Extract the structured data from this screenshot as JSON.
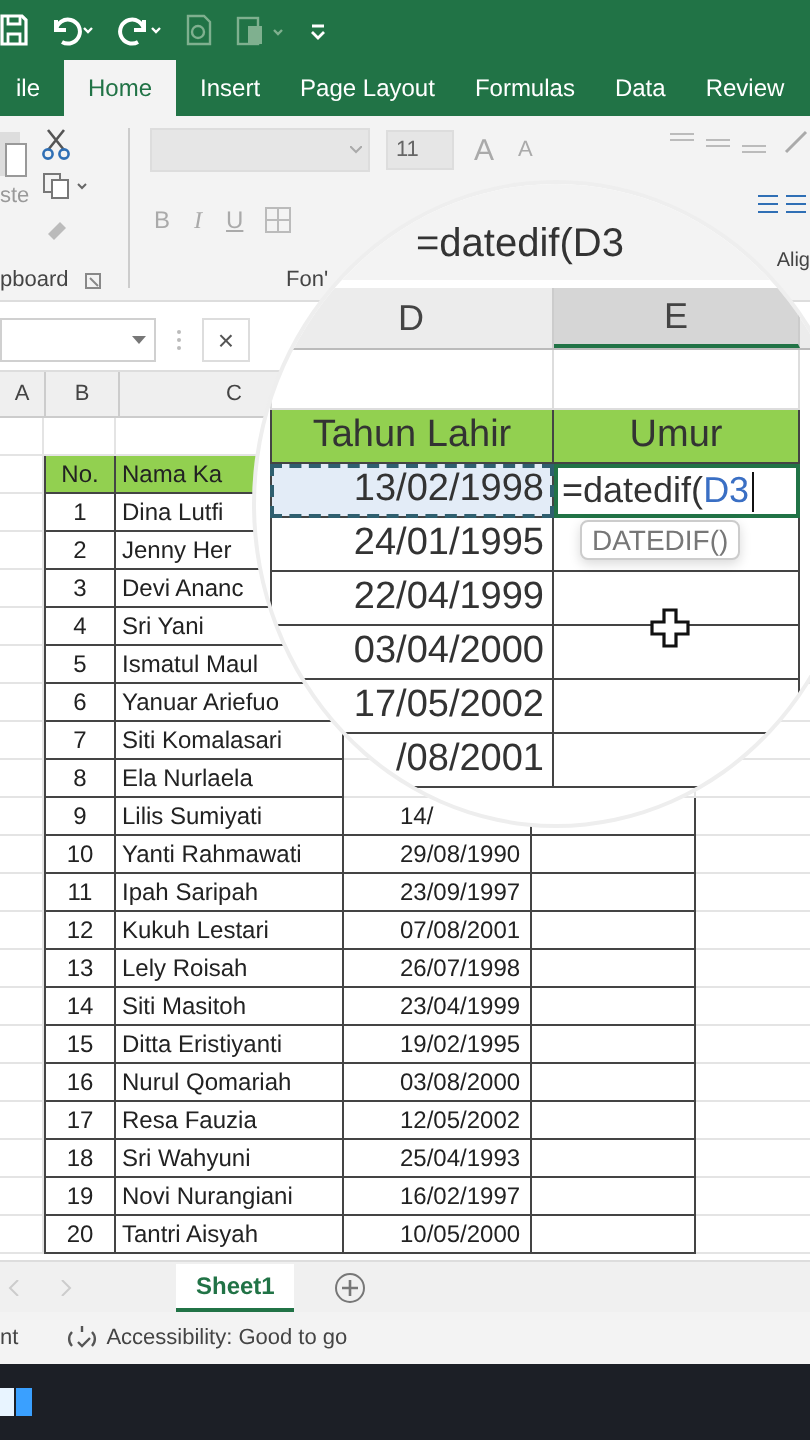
{
  "tabs": [
    {
      "label": "ile",
      "selected": false
    },
    {
      "label": "Home",
      "selected": true
    },
    {
      "label": "Insert",
      "selected": false
    },
    {
      "label": "Page Layout",
      "selected": false
    },
    {
      "label": "Formulas",
      "selected": false
    },
    {
      "label": "Data",
      "selected": false
    },
    {
      "label": "Review",
      "selected": false
    }
  ],
  "ribbon": {
    "clipboard": {
      "paste": "ste",
      "label": "pboard"
    },
    "font": {
      "size": "11",
      "grow": "A",
      "shrink": "A",
      "bold": "B",
      "italic": "I",
      "underline": "U",
      "label": "Fon'"
    },
    "alignment": {
      "label": "Alig"
    }
  },
  "formula_bar": {
    "cancel": "×"
  },
  "columns": [
    "A",
    "B",
    "C"
  ],
  "table": {
    "headers": [
      "No.",
      "Nama Ka"
    ],
    "rows": [
      {
        "no": "1",
        "name": "Dina Lutfi"
      },
      {
        "no": "2",
        "name": "Jenny Her"
      },
      {
        "no": "3",
        "name": "Devi Ananc"
      },
      {
        "no": "4",
        "name": "Sri Yani"
      },
      {
        "no": "5",
        "name": "Ismatul Maul"
      },
      {
        "no": "6",
        "name": "Yanuar Ariefuo"
      },
      {
        "no": "7",
        "name": "Siti Komalasari"
      },
      {
        "no": "8",
        "name": "Ela Nurlaela"
      },
      {
        "no": "9",
        "name": "Lilis Sumiyati",
        "date": "14/"
      },
      {
        "no": "10",
        "name": "Yanti Rahmawati",
        "date": "29/08/1990"
      },
      {
        "no": "11",
        "name": "Ipah Saripah",
        "date": "23/09/1997"
      },
      {
        "no": "12",
        "name": "Kukuh Lestari",
        "date": "07/08/2001"
      },
      {
        "no": "13",
        "name": "Lely Roisah",
        "date": "26/07/1998"
      },
      {
        "no": "14",
        "name": "Siti Masitoh",
        "date": "23/04/1999"
      },
      {
        "no": "15",
        "name": "Ditta Eristiyanti",
        "date": "19/02/1995"
      },
      {
        "no": "16",
        "name": "Nurul Qomariah",
        "date": "03/08/2000"
      },
      {
        "no": "17",
        "name": "Resa Fauzia",
        "date": "12/05/2002"
      },
      {
        "no": "18",
        "name": "Sri Wahyuni",
        "date": "25/04/1993"
      },
      {
        "no": "19",
        "name": "Novi Nurangiani",
        "date": "16/02/1997"
      },
      {
        "no": "20",
        "name": "Tantri Aisyah",
        "date": "10/05/2000"
      }
    ]
  },
  "magnifier": {
    "formula": "=datedif(D3",
    "columns": [
      "D",
      "E"
    ],
    "headers": [
      "Tahun Lahir",
      "Umur"
    ],
    "rows": [
      {
        "date": "13/02/1998",
        "selected": true
      },
      {
        "date": "24/01/1995",
        "selected": false
      },
      {
        "date": "22/04/1999",
        "selected": false
      },
      {
        "date": "03/04/2000",
        "selected": false
      },
      {
        "date": "17/05/2002",
        "selected": false
      },
      {
        "date": "/08/2001",
        "selected": false
      }
    ],
    "editing": {
      "text": "=datedif(",
      "ref": "D3"
    },
    "tooltip": "DATEDIF()"
  },
  "sheet_tabs": [
    {
      "label": "Sheet1",
      "selected": true
    }
  ],
  "status_bar": {
    "mode": "nt",
    "accessibility": "Accessibility: Good to go"
  }
}
